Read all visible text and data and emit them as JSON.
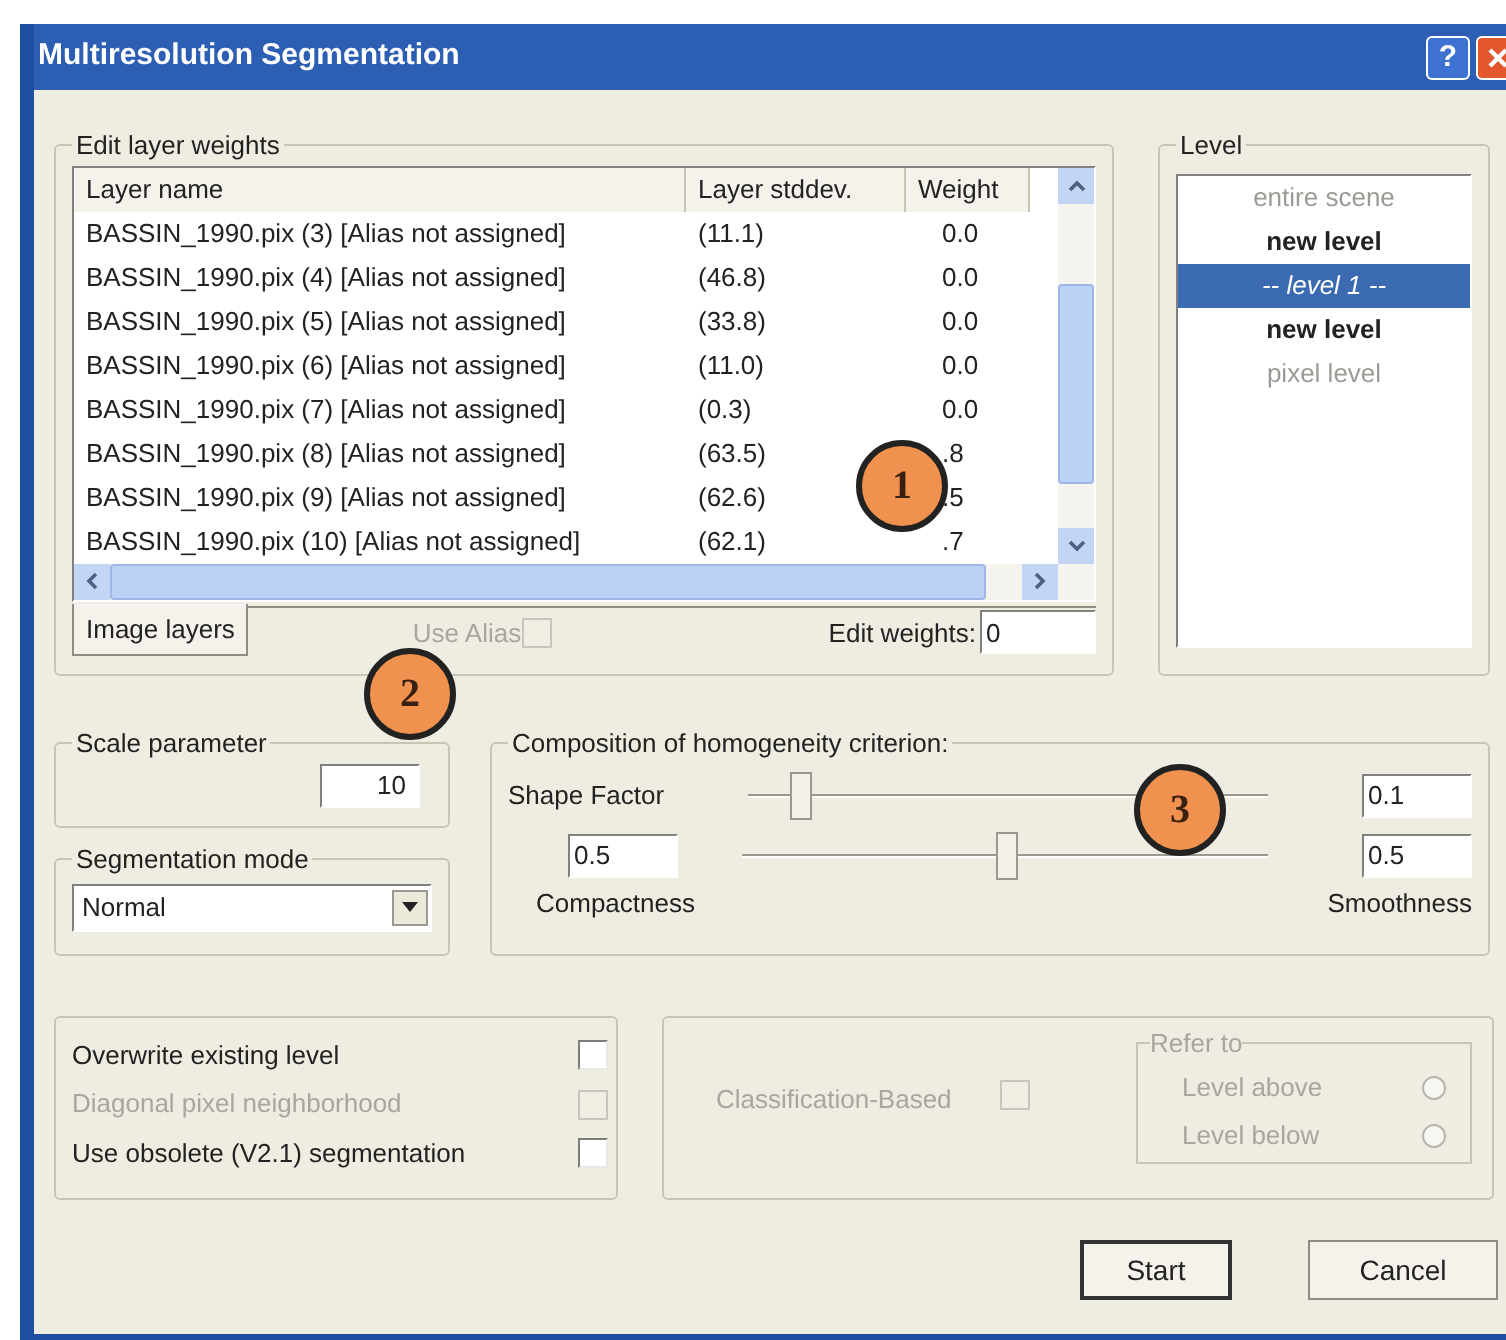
{
  "window": {
    "title": "Multiresolution Segmentation",
    "help_button": "?"
  },
  "layer_weights": {
    "title": "Edit layer weights",
    "columns": [
      "Layer name",
      "Layer stddev.",
      "Weight"
    ],
    "rows": [
      {
        "name": "BASSIN_1990.pix (3) [Alias not assigned]",
        "stddev": "(11.1)",
        "weight": "0.0"
      },
      {
        "name": "BASSIN_1990.pix (4) [Alias not assigned]",
        "stddev": "(46.8)",
        "weight": "0.0"
      },
      {
        "name": "BASSIN_1990.pix (5) [Alias not assigned]",
        "stddev": "(33.8)",
        "weight": "0.0"
      },
      {
        "name": "BASSIN_1990.pix (6) [Alias not assigned]",
        "stddev": "(11.0)",
        "weight": "0.0"
      },
      {
        "name": "BASSIN_1990.pix (7) [Alias not assigned]",
        "stddev": "(0.3)",
        "weight": "0.0"
      },
      {
        "name": "BASSIN_1990.pix (8) [Alias not assigned]",
        "stddev": "(63.5)",
        "weight": ".8"
      },
      {
        "name": "BASSIN_1990.pix (9) [Alias not assigned]",
        "stddev": "(62.6)",
        "weight": ".5"
      },
      {
        "name": "BASSIN_1990.pix (10) [Alias not assigned]",
        "stddev": "(62.1)",
        "weight": ".7"
      }
    ],
    "tab": {
      "label": "Image layers",
      "selected": true
    },
    "use_alias": {
      "label": "Use Alias",
      "checked": false,
      "disabled": true
    },
    "edit_weights": {
      "label": "Edit weights:",
      "value": "0"
    }
  },
  "level": {
    "title": "Level",
    "items": [
      {
        "label": "entire scene",
        "kind": "fixed",
        "selected": false
      },
      {
        "label": "new level",
        "kind": "new",
        "selected": false
      },
      {
        "label": "-- level 1 --",
        "kind": "existing",
        "selected": true
      },
      {
        "label": "new level",
        "kind": "new",
        "selected": false
      },
      {
        "label": "pixel level",
        "kind": "fixed",
        "selected": false
      }
    ]
  },
  "scale_parameter": {
    "title": "Scale parameter",
    "value": "10"
  },
  "segmentation_mode": {
    "title": "Segmentation mode",
    "value": "Normal"
  },
  "homogeneity": {
    "title": "Composition of homogeneity criterion:",
    "shape": {
      "label": "Shape Factor",
      "level": 0.1,
      "value": "0.1"
    },
    "balance": {
      "level": 0.5
    },
    "compactness": {
      "label": "Compactness",
      "value": "0.5"
    },
    "smoothness": {
      "label": "Smoothness",
      "value": "0.5"
    }
  },
  "options": [
    {
      "label": "Overwrite existing level",
      "checked": false,
      "disabled": false
    },
    {
      "label": "Diagonal pixel neighborhood",
      "checked": false,
      "disabled": true
    },
    {
      "label": "Use obsolete (V2.1) segmentation",
      "checked": false,
      "disabled": false
    }
  ],
  "classification": {
    "label": "Classification-Based",
    "checked": false,
    "disabled": true
  },
  "refer_to": {
    "title": "Refer to",
    "disabled": true,
    "options": [
      {
        "label": "Level above",
        "selected": false
      },
      {
        "label": "Level below",
        "selected": false
      }
    ]
  },
  "buttons": [
    {
      "label": "Start",
      "default": true
    },
    {
      "label": "Cancel",
      "default": false
    }
  ],
  "callouts": [
    "1",
    "2",
    "3"
  ]
}
